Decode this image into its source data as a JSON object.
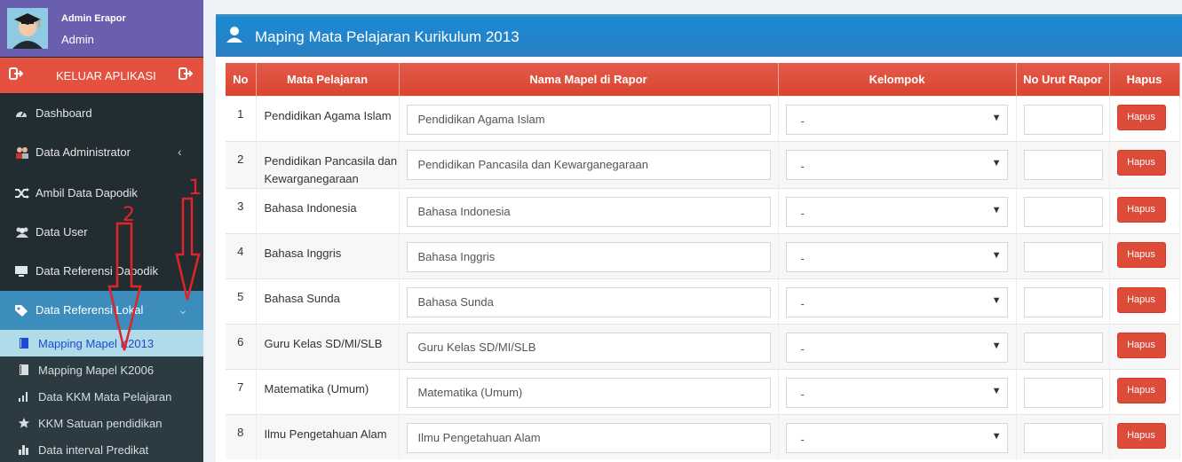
{
  "user": {
    "name": "Admin Erapor",
    "role": "Admin"
  },
  "logout_label": "KELUAR APLIKASI",
  "nav": [
    {
      "label": "Dashboard",
      "icon": "dashboard-icon"
    },
    {
      "label": "Data Administrator",
      "icon": "users-icon"
    },
    {
      "label": "Ambil Data Dapodik",
      "icon": "shuffle-icon"
    },
    {
      "label": "Data User",
      "icon": "user-group-icon"
    },
    {
      "label": "Data Referensi Dapodik",
      "icon": "desktop-icon"
    },
    {
      "label": "Data Referensi Lokal",
      "icon": "tags-icon"
    }
  ],
  "submenu": [
    {
      "label": "Mapping Mapel K2013",
      "icon": "book-icon"
    },
    {
      "label": "Mapping Mapel K2006",
      "icon": "book-icon"
    },
    {
      "label": "Data KKM Mata Pelajaran",
      "icon": "bar-chart-icon"
    },
    {
      "label": "KKM Satuan pendidikan",
      "icon": "star-icon"
    },
    {
      "label": "Data interval Predikat",
      "icon": "bar-chart-icon"
    }
  ],
  "annotations": [
    "1",
    "2"
  ],
  "panel_title": "Maping Mata Pelajaran Kurikulum 2013",
  "columns": [
    "No",
    "Mata Pelajaran",
    "Nama Mapel di Rapor",
    "Kelompok",
    "No Urut Rapor",
    "Hapus"
  ],
  "rows": [
    {
      "no": "1",
      "mapel": "Pendidikan Agama Islam",
      "rapor": "Pendidikan Agama Islam",
      "kelompok": "-",
      "button": "Hapus"
    },
    {
      "no": "2",
      "mapel": "Pendidikan Pancasila dan Kewarganegaraan",
      "rapor": "Pendidikan Pancasila dan Kewarganegaraan",
      "kelompok": "-",
      "button": "Hapus"
    },
    {
      "no": "3",
      "mapel": "Bahasa Indonesia",
      "rapor": "Bahasa Indonesia",
      "kelompok": "-",
      "button": "Hapus"
    },
    {
      "no": "4",
      "mapel": "Bahasa Inggris",
      "rapor": "Bahasa Inggris",
      "kelompok": "-",
      "button": "Hapus"
    },
    {
      "no": "5",
      "mapel": "Bahasa Sunda",
      "rapor": "Bahasa Sunda",
      "kelompok": "-",
      "button": "Hapus"
    },
    {
      "no": "6",
      "mapel": "Guru Kelas SD/MI/SLB",
      "rapor": "Guru Kelas SD/MI/SLB",
      "kelompok": "-",
      "button": "Hapus"
    },
    {
      "no": "7",
      "mapel": "Matematika (Umum)",
      "rapor": "Matematika (Umum)",
      "kelompok": "-",
      "button": "Hapus"
    },
    {
      "no": "8",
      "mapel": "Ilmu Pengetahuan Alam",
      "rapor": "Ilmu Pengetahuan Alam",
      "kelompok": "-",
      "button": "Hapus"
    }
  ],
  "colors": {
    "sidebar": "#222d32",
    "accent": "#3c8dbc",
    "danger": "#dd4b39",
    "user_panel": "#6a5fae"
  }
}
